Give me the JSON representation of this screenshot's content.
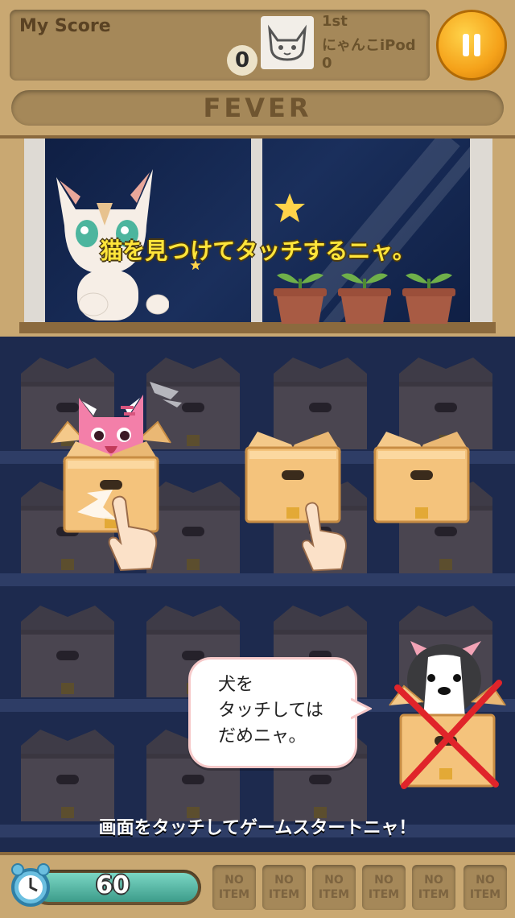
{
  "header": {
    "score_label": "My Score",
    "score_value": "0",
    "rank_position": "1st",
    "rank_name": "にゃんこiPod",
    "rank_score": "0",
    "fever_label": "FEVER"
  },
  "scene": {
    "instruction": "猫を見つけてタッチするニャ。"
  },
  "speech": {
    "text": "犬を\nタッチしては\nだめニャ。"
  },
  "start_prompt": "画面をタッチしてゲームスタートニャ！",
  "timer": {
    "value": "60",
    "fill_fraction": 1.0
  },
  "items": [
    {
      "label": "NO\nITEM"
    },
    {
      "label": "NO\nITEM"
    },
    {
      "label": "NO\nITEM"
    },
    {
      "label": "NO\nITEM"
    },
    {
      "label": "NO\nITEM"
    },
    {
      "label": "NO\nITEM"
    }
  ],
  "colors": {
    "instruction": "#ffe53a",
    "pause": "#f5a21a",
    "box": "#f2c07a",
    "cross": "#e0242a"
  }
}
